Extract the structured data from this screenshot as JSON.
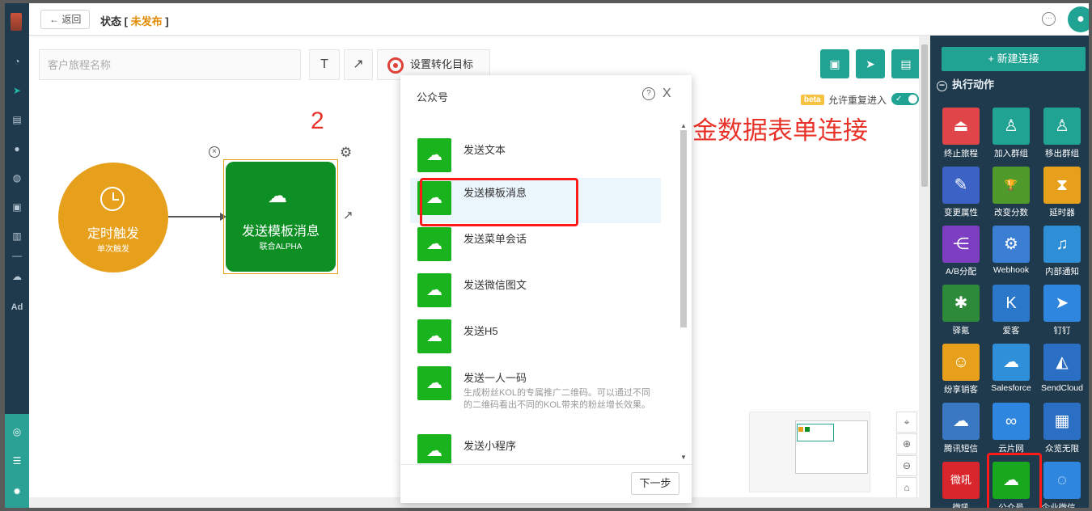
{
  "topbar": {
    "back_label": "← 返回",
    "status_label": "状态 [ ",
    "status_value": "未发布",
    "status_close": " ]"
  },
  "toolbar": {
    "name_placeholder": "客户旅程名称",
    "text_tool": "T",
    "arrow_tool": "↗",
    "goal_label": "设置转化目标",
    "save_icon": "save-icon",
    "send_icon": "send-icon",
    "layout_icon": "layout-icon"
  },
  "options": {
    "beta": "beta",
    "repeat_label": "允许重复进入",
    "repeat_enabled": true
  },
  "annotations": {
    "step": "2",
    "note": "此处编辑展会邀约信息+金数据表单连接"
  },
  "nodes": {
    "timer": {
      "title": "定时触发",
      "sub": "单次触发"
    },
    "wechat": {
      "title": "发送模板消息",
      "sub": "联合ALPHA"
    }
  },
  "modal": {
    "title": "公众号",
    "help": "?",
    "close": "X",
    "next_label": "下一步",
    "items": [
      {
        "title": "发送文本",
        "desc": ""
      },
      {
        "title": "发送模板消息",
        "desc": "",
        "selected": true
      },
      {
        "title": "发送菜单会话",
        "desc": ""
      },
      {
        "title": "发送微信图文",
        "desc": ""
      },
      {
        "title": "发送H5",
        "desc": ""
      },
      {
        "title": "发送一人一码",
        "desc": "生成粉丝KOL的专属推广二维码。可以通过不同的二维码看出不同的KOL带来的粉丝增长效果。"
      },
      {
        "title": "发送小程序",
        "desc": ""
      }
    ]
  },
  "panel": {
    "new_conn": "+ 新建连接",
    "section": "执行动作",
    "section_mark": "−",
    "tiles": [
      {
        "label": "终止旅程",
        "color": "#e0454a",
        "glyph": "⏏"
      },
      {
        "label": "加入群组",
        "color": "#21a394",
        "glyph": "♙"
      },
      {
        "label": "移出群组",
        "color": "#21a394",
        "glyph": "♙"
      },
      {
        "label": "变更属性",
        "color": "#3b62c4",
        "glyph": "✎"
      },
      {
        "label": "改变分数",
        "color": "#4f9a2a",
        "glyph": "🏆"
      },
      {
        "label": "延时器",
        "color": "#e7a01b",
        "glyph": "⧗"
      },
      {
        "label": "A/B分配",
        "color": "#7d3ec2",
        "glyph": "⋲"
      },
      {
        "label": "Webhook",
        "color": "#3b7fd4",
        "glyph": "⚙"
      },
      {
        "label": "内部通知",
        "color": "#2e8fd6",
        "glyph": "♫"
      },
      {
        "label": "驿氪",
        "color": "#2d8a3a",
        "glyph": "✱"
      },
      {
        "label": "爱客",
        "color": "#2b77c9",
        "glyph": "K"
      },
      {
        "label": "钉钉",
        "color": "#2e86de",
        "glyph": "➤"
      },
      {
        "label": "纷享销客",
        "color": "#e7a01b",
        "glyph": "☺"
      },
      {
        "label": "Salesforce",
        "color": "#2f8fd9",
        "glyph": "☁"
      },
      {
        "label": "SendCloud",
        "color": "#2b6fc4",
        "glyph": "◭"
      },
      {
        "label": "腾讯短信",
        "color": "#3b78c4",
        "glyph": "☁"
      },
      {
        "label": "云片网",
        "color": "#2e86de",
        "glyph": "∞"
      },
      {
        "label": "众览无限",
        "color": "#2b6fc4",
        "glyph": "▦"
      },
      {
        "label": "微吼",
        "color": "#d9262c",
        "glyph": "微吼"
      },
      {
        "label": "公众号",
        "color": "#19a81d",
        "glyph": "☁"
      },
      {
        "label": "企业微信...",
        "color": "#2e86de",
        "glyph": "◌"
      }
    ]
  },
  "colors": {
    "brand": "#21a394",
    "rail": "#1f3a4d",
    "timer": "#e7a01b",
    "wechat": "#0d8f24",
    "annotation": "#e8332a"
  }
}
